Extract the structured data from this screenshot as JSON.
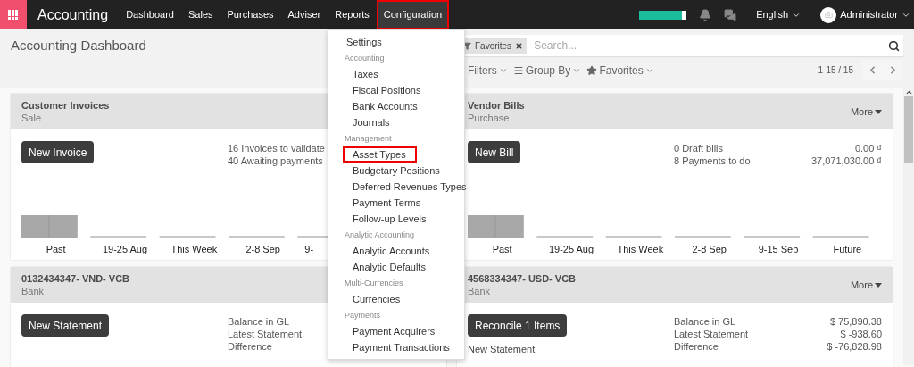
{
  "navbar": {
    "brand": "Accounting",
    "menus": [
      {
        "label": "Dashboard",
        "selected": false,
        "annotated": false
      },
      {
        "label": "Sales",
        "selected": false,
        "annotated": false
      },
      {
        "label": "Purchases",
        "selected": false,
        "annotated": false
      },
      {
        "label": "Adviser",
        "selected": false,
        "annotated": false
      },
      {
        "label": "Reports",
        "selected": false,
        "annotated": false
      },
      {
        "label": "Configuration",
        "selected": true,
        "annotated": true
      }
    ],
    "language": "English",
    "user": "Administrator"
  },
  "dropdown": {
    "items": [
      {
        "kind": "item",
        "label": "Settings",
        "annotated": false
      },
      {
        "kind": "header",
        "label": "Accounting"
      },
      {
        "kind": "item",
        "label": "Taxes",
        "annotated": false
      },
      {
        "kind": "item",
        "label": "Fiscal Positions",
        "annotated": false
      },
      {
        "kind": "item",
        "label": "Bank Accounts",
        "annotated": false
      },
      {
        "kind": "item",
        "label": "Journals",
        "annotated": false
      },
      {
        "kind": "header",
        "label": "Management"
      },
      {
        "kind": "item",
        "label": "Asset Types",
        "annotated": true
      },
      {
        "kind": "item",
        "label": "Budgetary Positions",
        "annotated": false
      },
      {
        "kind": "item",
        "label": "Deferred Revenues Types",
        "annotated": false
      },
      {
        "kind": "item",
        "label": "Payment Terms",
        "annotated": false
      },
      {
        "kind": "item",
        "label": "Follow-up Levels",
        "annotated": false
      },
      {
        "kind": "header",
        "label": "Analytic Accounting"
      },
      {
        "kind": "item",
        "label": "Analytic Accounts",
        "annotated": false
      },
      {
        "kind": "item",
        "label": "Analytic Defaults",
        "annotated": false
      },
      {
        "kind": "header",
        "label": "Multi-Currencies"
      },
      {
        "kind": "item",
        "label": "Currencies",
        "annotated": false
      },
      {
        "kind": "header",
        "label": "Payments"
      },
      {
        "kind": "item",
        "label": "Payment Acquirers",
        "annotated": false
      },
      {
        "kind": "item",
        "label": "Payment Transactions",
        "annotated": false
      }
    ]
  },
  "control_panel": {
    "title": "Accounting Dashboard",
    "search": {
      "facets": [
        {
          "label": "Favorites"
        }
      ],
      "placeholder": "Search..."
    },
    "filters": [
      {
        "kind": "filter",
        "label": "Filters"
      },
      {
        "kind": "group",
        "label": "Group By"
      },
      {
        "kind": "favorites",
        "label": "Favorites"
      }
    ],
    "pager": "1-15 / 15"
  },
  "cards": [
    {
      "title": "Customer Invoices",
      "subtitle": "Sale",
      "button": "New Invoice",
      "stats": [
        {
          "label": "16 Invoices to validate"
        },
        {
          "label": "40 Awaiting payments"
        }
      ],
      "chart_labels": [
        "Past",
        "19-25 Aug",
        "This Week",
        "2-8 Sep",
        "9-"
      ]
    },
    {
      "title": "Vendor Bills",
      "subtitle": "Purchase",
      "more": "More",
      "button": "New Bill",
      "stats": [
        {
          "label": "0 Draft bills",
          "value": "0.00 ₫"
        },
        {
          "label": "8 Payments to do",
          "value": "37,071,030.00 ₫"
        }
      ],
      "chart_labels": [
        "Past",
        "19-25 Aug",
        "This Week",
        "2-8 Sep",
        "9-15 Sep",
        "Future"
      ]
    },
    {
      "title": "0132434347- VND- VCB",
      "subtitle": "Bank",
      "button": "New Statement",
      "stats": [
        {
          "label": "Balance in GL"
        },
        {
          "label": "Latest Statement"
        },
        {
          "label": "Difference"
        }
      ]
    },
    {
      "title": "4568334347- USD- VCB",
      "subtitle": "Bank",
      "more": "More",
      "button": "Reconcile 1 Items",
      "link": "New Statement",
      "stats": [
        {
          "label": "Balance in GL",
          "value": "$ 75,890.38"
        },
        {
          "label": "Latest Statement",
          "value": "$ -938.60"
        },
        {
          "label": "Difference",
          "value": "$ -76,828.98"
        }
      ]
    }
  ]
}
